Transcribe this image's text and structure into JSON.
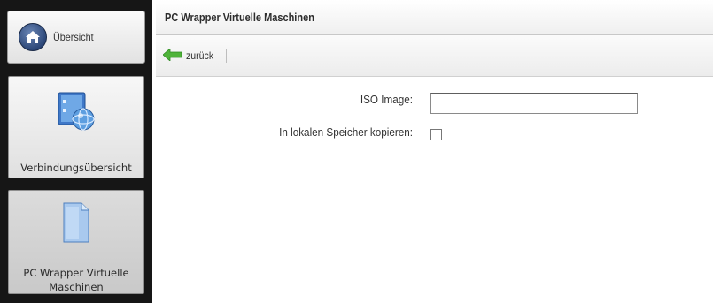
{
  "sidebar": {
    "home_label": "Übersicht",
    "items": [
      {
        "label": "Verbindungsübersicht",
        "icon": "network-monitor-icon"
      },
      {
        "label_line1": "PC Wrapper Virtuelle",
        "label_line2": "Maschinen",
        "icon": "document-icon"
      }
    ]
  },
  "header": {
    "title": "PC Wrapper Virtuelle Maschinen"
  },
  "toolbar": {
    "back_label": "zurück"
  },
  "form": {
    "iso_label": "ISO Image:",
    "iso_value": "",
    "copy_label": "In lokalen Speicher kopieren:",
    "copy_checked": false
  },
  "colors": {
    "sidebar_bg": "#161616",
    "back_arrow": "#4fb33a"
  }
}
